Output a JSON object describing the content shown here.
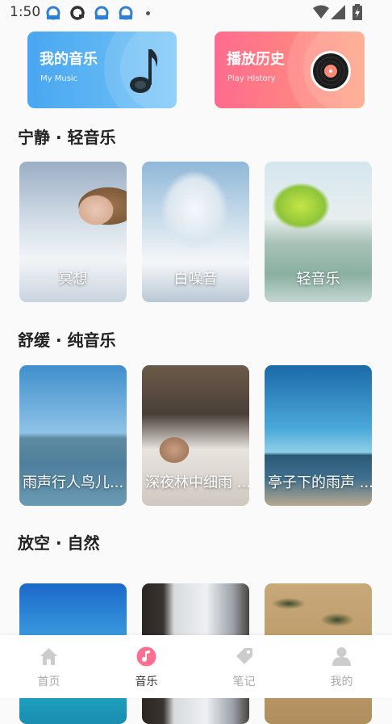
{
  "status_bar": {
    "time": "1:50"
  },
  "feature_cards": [
    {
      "title": "我的音乐",
      "subtitle": "My Music",
      "icon": "music-note-icon"
    },
    {
      "title": "播放历史",
      "subtitle": "Play History",
      "icon": "vinyl-record-icon"
    }
  ],
  "sections": [
    {
      "title": "宁静 · 轻音乐",
      "items": [
        {
          "label": "冥想"
        },
        {
          "label": "白噪音"
        },
        {
          "label": "轻音乐"
        }
      ]
    },
    {
      "title": "舒缓 · 纯音乐",
      "items": [
        {
          "label": "雨声行人鸟儿..."
        },
        {
          "label": "深夜林中细雨 ..."
        },
        {
          "label": "亭子下的雨声 ..."
        }
      ]
    },
    {
      "title": "放空 · 自然",
      "items": [
        {
          "label": ""
        },
        {
          "label": ""
        },
        {
          "label": ""
        }
      ]
    }
  ],
  "tabs": [
    {
      "label": "首页",
      "icon": "home-icon",
      "active": false
    },
    {
      "label": "音乐",
      "icon": "music-icon",
      "active": true
    },
    {
      "label": "笔记",
      "icon": "note-tag-icon",
      "active": false
    },
    {
      "label": "我的",
      "icon": "profile-icon",
      "active": false
    }
  ],
  "colors": {
    "music_card": "#49a6f0",
    "history_card": "#ff6b8e",
    "active_tab_icon": "#ff6f8f",
    "inactive_tab": "#cccccc"
  }
}
